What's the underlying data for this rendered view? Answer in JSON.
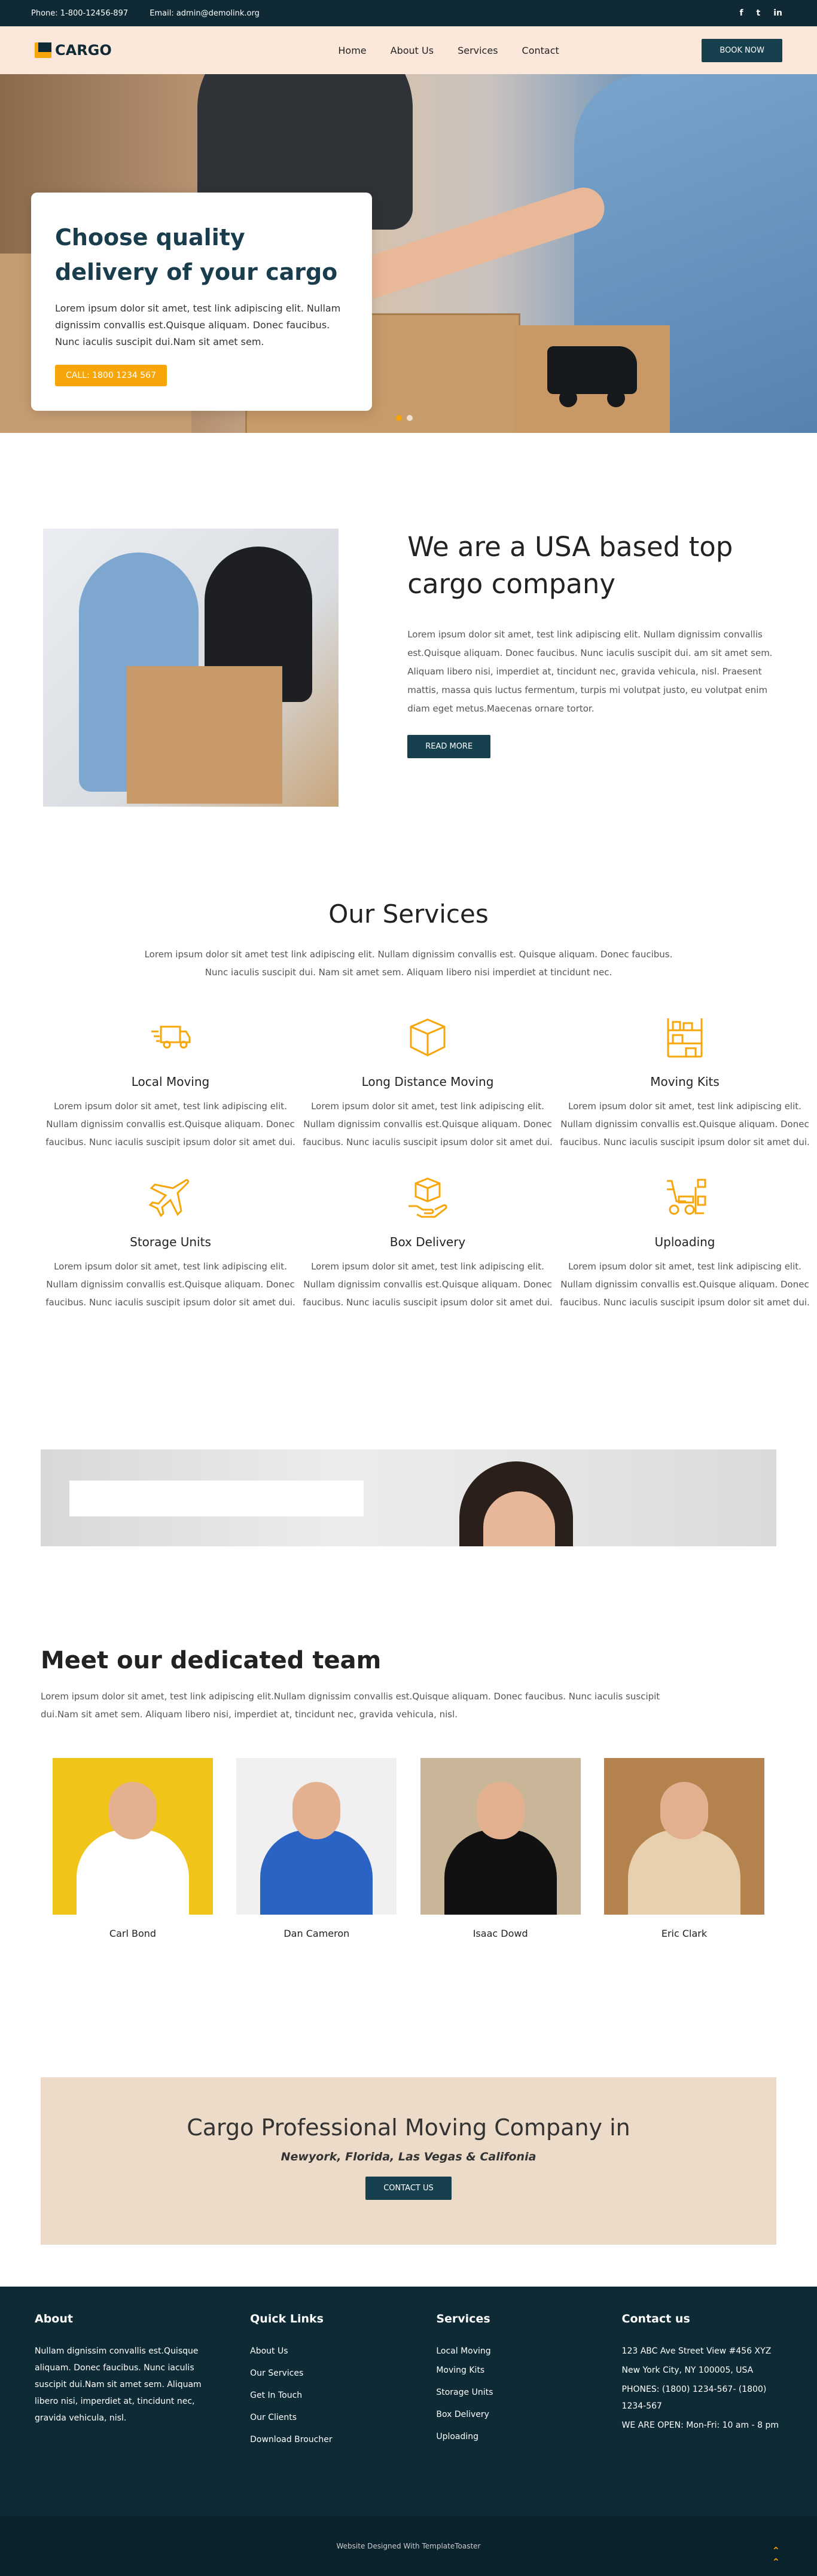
{
  "topbar": {
    "phone": "Phone: 1-800-12456-897",
    "email": "Email: admin@demolink.org",
    "social": [
      "f",
      "t",
      "in"
    ]
  },
  "header": {
    "logo": "CARGO",
    "nav": [
      "Home",
      "About Us",
      "Services",
      "Contact"
    ],
    "cta": "BOOK NOW"
  },
  "hero": {
    "title": "Choose quality delivery of your cargo",
    "text": "Lorem ipsum dolor sit amet, test link adipiscing elit. Nullam dignissim convallis est.Quisque aliquam. Donec faucibus. Nunc iaculis suscipit dui.Nam sit amet sem.",
    "button": "CALL: 1800 1234 567",
    "slides": 2
  },
  "about": {
    "title": "We are a USA based top cargo company",
    "text": "Lorem ipsum dolor sit amet, test link adipiscing elit. Nullam dignissim convallis est.Quisque aliquam. Donec faucibus. Nunc iaculis suscipit dui. am sit amet sem. Aliquam libero nisi, imperdiet at, tincidunt nec, gravida vehicula, nisl. Praesent mattis, massa quis luctus fermentum, turpis mi volutpat justo, eu volutpat enim diam eget metus.Maecenas ornare tortor.",
    "button": "READ MORE"
  },
  "services": {
    "title": "Our Services",
    "intro": "Lorem ipsum dolor sit amet test link adipiscing elit. Nullam dignissim convallis est. Quisque aliquam. Donec faucibus. Nunc iaculis suscipit dui. Nam sit amet sem. Aliquam libero nisi imperdiet at tincidunt nec.",
    "items": [
      {
        "title": "Local Moving",
        "icon": "delivery-truck-icon",
        "text": "Lorem ipsum dolor sit amet, test link adipiscing elit. Nullam dignissim convallis est.Quisque aliquam. Donec faucibus. Nunc iaculis suscipit ipsum dolor sit amet dui."
      },
      {
        "title": "Long Distance Moving",
        "icon": "box-icon",
        "text": "Lorem ipsum dolor sit amet, test link adipiscing elit. Nullam dignissim convallis est.Quisque aliquam. Donec faucibus. Nunc iaculis suscipit ipsum dolor sit amet dui."
      },
      {
        "title": "Moving Kits",
        "icon": "shelves-icon",
        "text": "Lorem ipsum dolor sit amet, test link adipiscing elit. Nullam dignissim convallis est.Quisque aliquam. Donec faucibus. Nunc iaculis suscipit ipsum dolor sit amet dui."
      },
      {
        "title": "Storage Units",
        "icon": "airplane-icon",
        "text": "Lorem ipsum dolor sit amet, test link adipiscing elit. Nullam dignissim convallis est.Quisque aliquam. Donec faucibus. Nunc iaculis suscipit ipsum dolor sit amet dui."
      },
      {
        "title": "Box Delivery",
        "icon": "hand-box-icon",
        "text": "Lorem ipsum dolor sit amet, test link adipiscing elit. Nullam dignissim convallis est.Quisque aliquam. Donec faucibus. Nunc iaculis suscipit ipsum dolor sit amet dui."
      },
      {
        "title": "Uploading",
        "icon": "forklift-icon",
        "text": "Lorem ipsum dolor sit amet, test link adipiscing elit. Nullam dignissim convallis est.Quisque aliquam. Donec faucibus. Nunc iaculis suscipit ipsum dolor sit amet dui."
      }
    ]
  },
  "team": {
    "title": "Meet our dedicated team",
    "intro": "Lorem ipsum dolor sit amet, test link adipiscing elit.Nullam dignissim convallis est.Quisque aliquam. Donec faucibus. Nunc iaculis suscipit dui.Nam sit amet sem. Aliquam libero nisi, imperdiet at, tincidunt nec, gravida vehicula, nisl.",
    "members": [
      {
        "name": "Carl Bond",
        "bg": "#f0c419",
        "shirt": "#ffffff"
      },
      {
        "name": "Dan Cameron",
        "bg": "#f0f0f0",
        "shirt": "#2a63c4"
      },
      {
        "name": "Isaac Dowd",
        "bg": "#c9b699",
        "shirt": "#111111"
      },
      {
        "name": "Eric Clark",
        "bg": "#b3824d",
        "shirt": "#e8cfae"
      }
    ]
  },
  "cta": {
    "title": "Cargo Professional Moving Company in",
    "subtitle": "Newyork, Florida, Las Vegas & Califonia",
    "button": "CONTACT US"
  },
  "footer": {
    "about": {
      "title": "About",
      "text": "Nullam dignissim convallis est.Quisque aliquam. Donec faucibus. Nunc iaculis suscipit dui.Nam sit amet sem. Aliquam libero nisi, imperdiet at, tincidunt nec, gravida vehicula, nisl."
    },
    "quick_links": {
      "title": "Quick Links",
      "items": [
        "About Us",
        "Our Services",
        "Get In Touch",
        "Our Clients",
        "Download Broucher"
      ]
    },
    "services": {
      "title": "Services",
      "items": [
        "Local Moving",
        "Moving Kits",
        "Storage Units",
        "Box Delivery",
        "Uploading"
      ]
    },
    "contact": {
      "title": "Contact us",
      "lines": [
        "123 ABC Ave Street View #456 XYZ",
        "New York City, NY 100005, USA",
        "PHONES: (1800) 1234-567- (1800) 1234-567",
        "WE ARE OPEN: Mon-Fri: 10 am - 8 pm"
      ]
    },
    "credit": "Website Designed With TemplateToaster"
  },
  "colors": {
    "primary": "#17404f",
    "accent": "#f6a609",
    "header_bg": "#fbe8db",
    "footer_bg": "#0e2a35"
  }
}
